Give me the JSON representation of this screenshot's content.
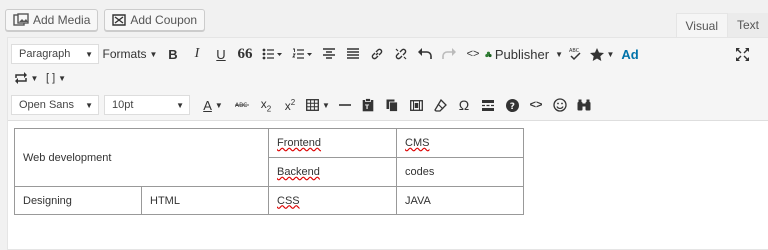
{
  "media_buttons": {
    "add_media": "Add Media",
    "add_coupon": "Add Coupon"
  },
  "editor_tabs": {
    "visual": "Visual",
    "text": "Text"
  },
  "toolbar1": {
    "paragraph": "Paragraph",
    "formats": "Formats",
    "bold": "B",
    "italic": "I",
    "underline": "U",
    "blockquote": "66",
    "publisher": "Publisher",
    "ad": "Ad",
    "shortcode": "[ ]"
  },
  "toolbar2": {
    "font_family": "Open Sans",
    "font_size": "10pt",
    "text_color": "A",
    "omega": "Ω"
  },
  "table": {
    "rows": [
      [
        "Web development",
        "Frontend",
        "CMS"
      ],
      [
        "Backend",
        "codes"
      ],
      [
        "Designing",
        "HTML",
        "CSS",
        "JAVA"
      ]
    ]
  },
  "colors": {
    "accent_blue": "#0073aa",
    "spell_underline": "#dd0000",
    "publisher_green": "#2e7d32"
  }
}
